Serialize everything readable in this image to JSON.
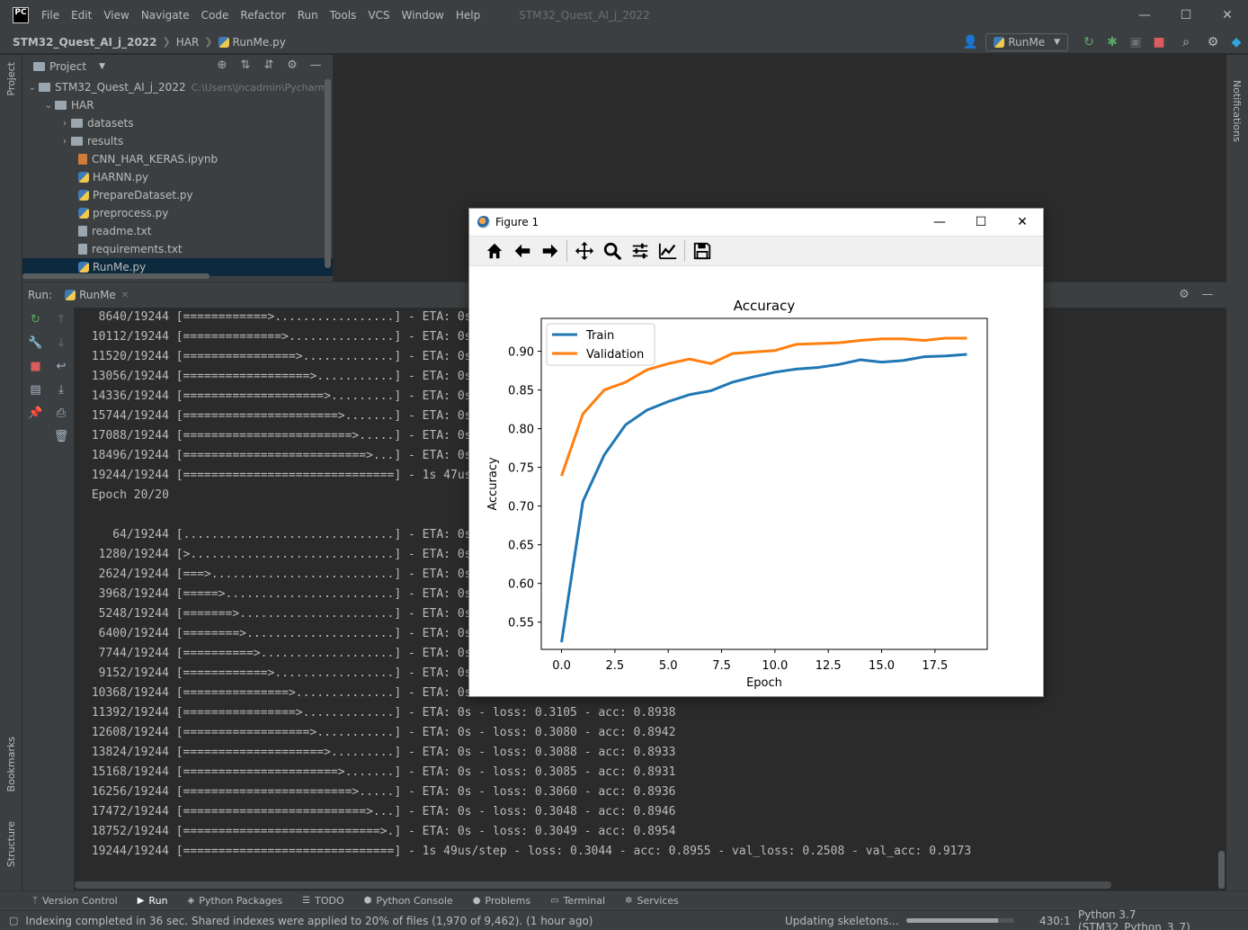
{
  "menubar": {
    "logo": "PC",
    "items": [
      "File",
      "Edit",
      "View",
      "Navigate",
      "Code",
      "Refactor",
      "Run",
      "Tools",
      "VCS",
      "Window",
      "Help"
    ],
    "window_title": "STM32_Quest_AI_j_2022"
  },
  "navbar": {
    "breadcrumb": [
      "STM32_Quest_AI_j_2022",
      "HAR",
      "RunMe.py"
    ],
    "run_config": "RunMe"
  },
  "left_strip": {
    "project": "Project",
    "bookmarks": "Bookmarks",
    "structure": "Structure"
  },
  "right_strip": {
    "notifications": "Notifications"
  },
  "project_panel": {
    "title": "Project",
    "root_name": "STM32_Quest_AI_j_2022",
    "root_path": "C:\\Users\\jncadmin\\Pycharm",
    "tree": [
      {
        "name": "HAR"
      },
      {
        "name": "datasets"
      },
      {
        "name": "results"
      },
      {
        "name": "CNN_HAR_KERAS.ipynb"
      },
      {
        "name": "HARNN.py"
      },
      {
        "name": "PrepareDataset.py"
      },
      {
        "name": "preprocess.py"
      },
      {
        "name": "readme.txt"
      },
      {
        "name": "requirements.txt"
      },
      {
        "name": "RunMe.py"
      }
    ]
  },
  "run_panel": {
    "label": "Run:",
    "tab": "RunMe",
    "console": [
      "  8640/19244 [============>.................] - ETA: 0s",
      " 10112/19244 [==============>...............] - ETA: 0s",
      " 11520/19244 [================>.............] - ETA: 0s",
      " 13056/19244 [==================>...........] - ETA: 0s",
      " 14336/19244 [====================>.........] - ETA: 0s",
      " 15744/19244 [======================>.......] - ETA: 0s",
      " 17088/19244 [========================>.....] - ETA: 0s",
      " 18496/19244 [==========================>...] - ETA: 0s",
      " 19244/19244 [==============================] - 1s 47us",
      " Epoch 20/20",
      "",
      "    64/19244 [..............................] - ETA: 0s",
      "  1280/19244 [>.............................] - ETA: 0s",
      "  2624/19244 [===>..........................] - ETA: 0s",
      "  3968/19244 [=====>........................] - ETA: 0s",
      "  5248/19244 [=======>......................] - ETA: 0s",
      "  6400/19244 [========>.....................] - ETA: 0s",
      "  7744/19244 [==========>...................] - ETA: 0s",
      "  9152/19244 [============>.................] - ETA: 0s",
      " 10368/19244 [===============>..............] - ETA: 0s",
      " 11392/19244 [================>.............] - ETA: 0s - loss: 0.3105 - acc: 0.8938",
      " 12608/19244 [==================>...........] - ETA: 0s - loss: 0.3080 - acc: 0.8942",
      " 13824/19244 [====================>.........] - ETA: 0s - loss: 0.3088 - acc: 0.8933",
      " 15168/19244 [======================>.......] - ETA: 0s - loss: 0.3085 - acc: 0.8931",
      " 16256/19244 [========================>.....] - ETA: 0s - loss: 0.3060 - acc: 0.8936",
      " 17472/19244 [==========================>...] - ETA: 0s - loss: 0.3048 - acc: 0.8946",
      " 18752/19244 [============================>.] - ETA: 0s - loss: 0.3049 - acc: 0.8954",
      " 19244/19244 [==============================] - 1s 49us/step - loss: 0.3044 - acc: 0.8955 - val_loss: 0.2508 - val_acc: 0.9173"
    ]
  },
  "bottom_tabs": [
    "Version Control",
    "Run",
    "Python Packages",
    "TODO",
    "Python Console",
    "Problems",
    "Terminal",
    "Services"
  ],
  "statusbar": {
    "message": "Indexing completed in 36 sec. Shared indexes were applied to 20% of files (1,970 of 9,462). (1 hour ago)",
    "task": "Updating skeletons...",
    "progress": 0.85,
    "position": "430:1",
    "interpreter": "Python 3.7 (STM32_Python_3_7)"
  },
  "figure": {
    "title": "Figure 1"
  },
  "colors": {
    "train": "#1f77b4",
    "validation": "#ff7f0e"
  },
  "chart_data": {
    "type": "line",
    "title": "Accuracy",
    "xlabel": "Epoch",
    "ylabel": "Accuracy",
    "x": [
      0,
      1,
      2,
      3,
      4,
      5,
      6,
      7,
      8,
      9,
      10,
      11,
      12,
      13,
      14,
      15,
      16,
      17,
      18,
      19
    ],
    "xlim": [
      -0.95,
      19.95
    ],
    "ylim": [
      0.5148,
      0.9425
    ],
    "xticks": [
      "0.0",
      "2.5",
      "5.0",
      "7.5",
      "10.0",
      "12.5",
      "15.0",
      "17.5"
    ],
    "xtick_values": [
      0,
      2.5,
      5,
      7.5,
      10,
      12.5,
      15,
      17.5
    ],
    "yticks": [
      "0.55",
      "0.60",
      "0.65",
      "0.70",
      "0.75",
      "0.80",
      "0.85",
      "0.90"
    ],
    "ytick_values": [
      0.55,
      0.6,
      0.65,
      0.7,
      0.75,
      0.8,
      0.85,
      0.9
    ],
    "legend_position": "upper-left",
    "series": [
      {
        "name": "Train",
        "color": "#1f77b4",
        "values": [
          0.524,
          0.706,
          0.766,
          0.805,
          0.824,
          0.835,
          0.844,
          0.849,
          0.86,
          0.867,
          0.873,
          0.877,
          0.879,
          0.883,
          0.889,
          0.886,
          0.888,
          0.893,
          0.894,
          0.896
        ]
      },
      {
        "name": "Validation",
        "color": "#ff7f0e",
        "values": [
          0.739,
          0.819,
          0.85,
          0.86,
          0.876,
          0.884,
          0.89,
          0.884,
          0.897,
          0.899,
          0.901,
          0.909,
          0.91,
          0.911,
          0.914,
          0.916,
          0.916,
          0.914,
          0.917,
          0.917
        ]
      }
    ]
  }
}
